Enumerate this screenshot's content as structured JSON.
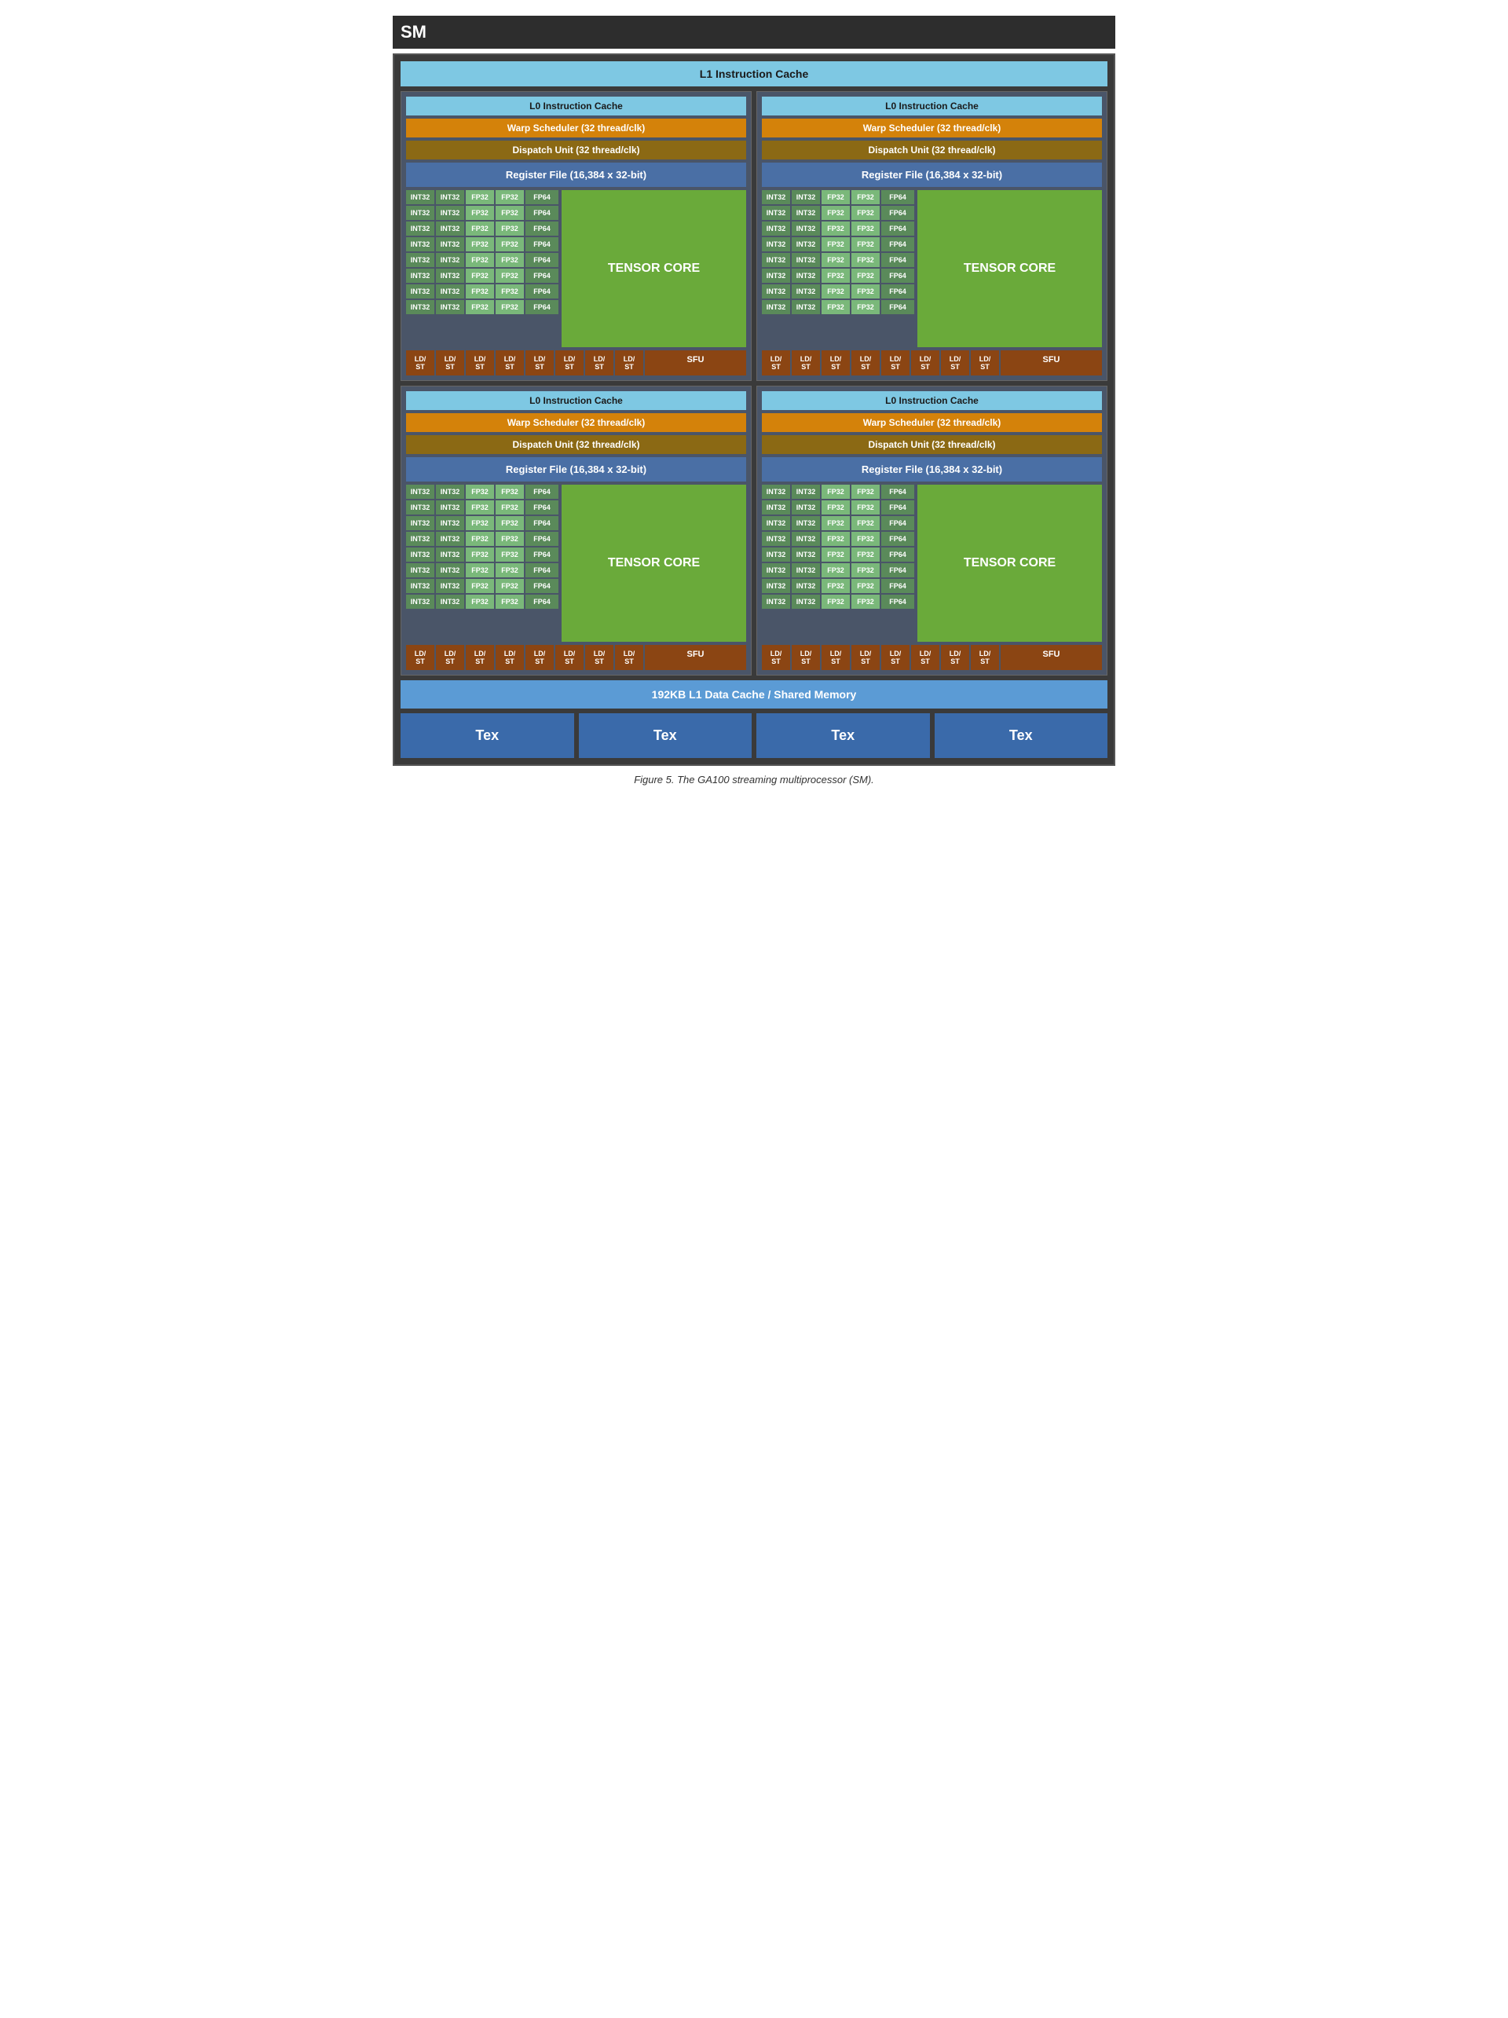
{
  "title": "SM",
  "l1_instruction_cache": "L1 Instruction Cache",
  "l1_data_cache": "192KB L1 Data Cache / Shared Memory",
  "figure_caption": "Figure 5. The GA100 streaming multiprocessor (SM).",
  "quadrant": {
    "l0_cache": "L0 Instruction Cache",
    "warp_scheduler": "Warp Scheduler (32 thread/clk)",
    "dispatch_unit": "Dispatch Unit (32 thread/clk)",
    "register_file": "Register File (16,384 x 32-bit)",
    "tensor_core": "TENSOR CORE",
    "sfu_label": "SFU"
  },
  "cores": {
    "int32": "INT32",
    "fp32": "FP32",
    "fp64": "FP64",
    "ld_st": "LD/\nST"
  },
  "tex_units": [
    "Tex",
    "Tex",
    "Tex",
    "Tex"
  ]
}
